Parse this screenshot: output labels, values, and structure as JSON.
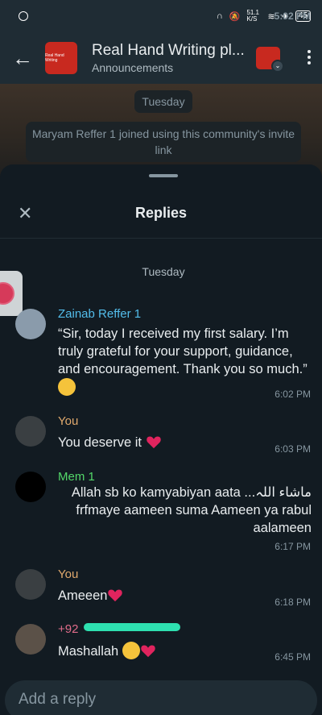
{
  "status": {
    "time": "5:02 PM",
    "net": "51.1 K/S",
    "battery": "45"
  },
  "header": {
    "title": "Real Hand Writing pl...",
    "subtitle": "Announcements",
    "avatar_text": "Real Hand Writing"
  },
  "background": {
    "day_chip": "Tuesday",
    "system_msg": "Maryam Reffer 1 joined using this community's invite link"
  },
  "sheet": {
    "title": "Replies",
    "day": "Tuesday"
  },
  "messages": [
    {
      "name": "Zainab Reffer 1",
      "name_color": "#53bdeb",
      "text": "“Sir, today I received my first salary. I’m truly grateful for your support, guidance, and encouragement. Thank you so much.”",
      "emoji": "😊",
      "time": "6:02 PM"
    },
    {
      "name": "You",
      "name_color": "#e0a96d",
      "text": "You deserve it",
      "emoji": "❤️",
      "time": "6:03 PM"
    },
    {
      "name": "Mem 1",
      "name_color": "#53d769",
      "text": "Allah sb ko kamyabiyan aata ...ماشاء اللہ frfmaye aameen suma Aameen ya rabul aalameen",
      "time": "6:17 PM"
    },
    {
      "name": "You",
      "name_color": "#e0a96d",
      "text": "Ameeen",
      "emoji": "❤️",
      "time": "6:18 PM"
    },
    {
      "name": "+92",
      "name_color": "#e06c8a",
      "text": "Mashallah",
      "emoji": "🥰❤️",
      "time": "6:45 PM"
    }
  ],
  "reply": {
    "placeholder": "Add a reply"
  },
  "colors": {
    "bg": "#121b22",
    "header": "#1f2c34",
    "accent_red": "#c8291f",
    "redact": "#2ee0b0"
  }
}
